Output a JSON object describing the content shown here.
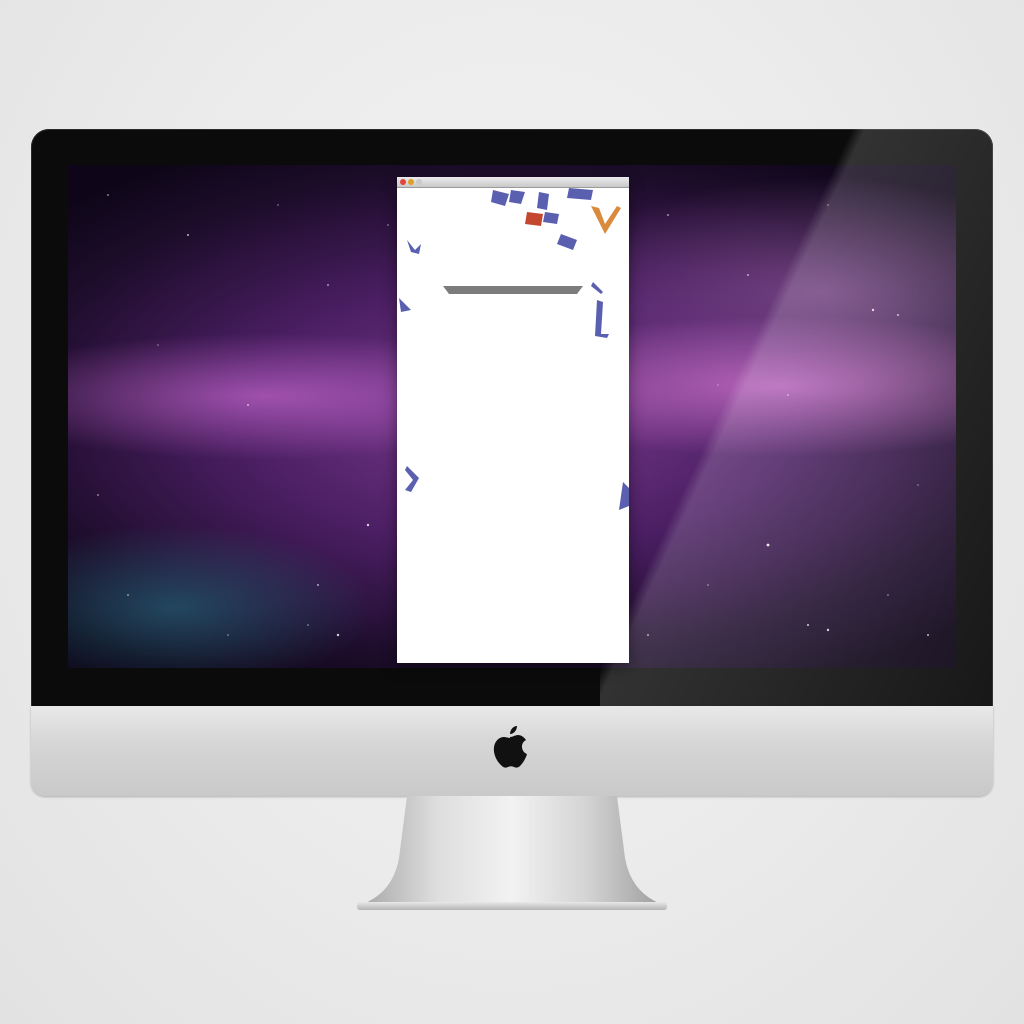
{
  "desktop": {
    "wallpaper": "aurora-galaxy",
    "accent_colors": [
      "#7a3a8e",
      "#e88ae0",
      "#1e0d2c"
    ]
  },
  "window": {
    "traffic_lights": {
      "close": "#e0443e",
      "minimize": "#dea123",
      "zoom": "#c9c9c9"
    }
  },
  "game": {
    "paddle_color": "#7c7c7c",
    "piece_colors": {
      "blue": "#5a5fb0",
      "orange": "#d98a3c",
      "red": "#c4472f"
    }
  },
  "hardware": {
    "logo_icon": "apple-logo-icon"
  }
}
